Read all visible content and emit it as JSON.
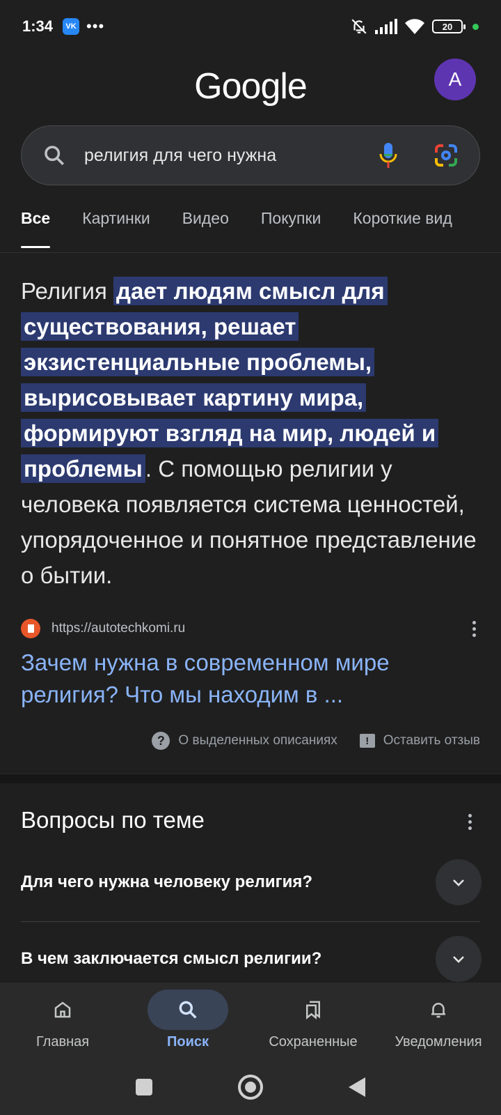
{
  "status_bar": {
    "time": "1:34",
    "vk_label": "VK",
    "more": "•••",
    "battery": "20"
  },
  "header": {
    "logo": "Google",
    "avatar_letter": "A"
  },
  "search": {
    "query": "религия для чего нужна"
  },
  "tabs": [
    {
      "label": "Все",
      "active": true
    },
    {
      "label": "Картинки"
    },
    {
      "label": "Видео"
    },
    {
      "label": "Покупки"
    },
    {
      "label": "Короткие вид"
    }
  ],
  "snippet": {
    "lead": "Религия ",
    "highlight": "дает людям смысл для существования, решает экзистенциальные проблемы, вырисовывает картину мира, формируют взгляд на мир, людей и проблемы",
    "rest": ". С помощью религии у человека появляется система ценностей, упорядоченное и понятное представление о бытии."
  },
  "result": {
    "url": "https://autotechkomi.ru",
    "title": "Зачем нужна в современном мире религия? Что мы находим в ..."
  },
  "feedback": {
    "about_label": "О выделенных описаниях",
    "feedback_label": "Оставить отзыв"
  },
  "questions": {
    "title": "Вопросы по теме",
    "items": [
      {
        "label": "Для чего нужна человеку религия?"
      },
      {
        "label": "В чем заключается смысл религии?"
      }
    ]
  },
  "bottom_nav": [
    {
      "label": "Главная",
      "icon": "home-icon"
    },
    {
      "label": "Поиск",
      "icon": "search-icon",
      "active": true
    },
    {
      "label": "Сохраненные",
      "icon": "bookmarks-icon"
    },
    {
      "label": "Уведомления",
      "icon": "bell-icon"
    }
  ],
  "colors": {
    "background": "#1f1f1f",
    "link": "#8ab4f8",
    "highlight": "#2c3a70",
    "avatar": "#5e35b1"
  }
}
